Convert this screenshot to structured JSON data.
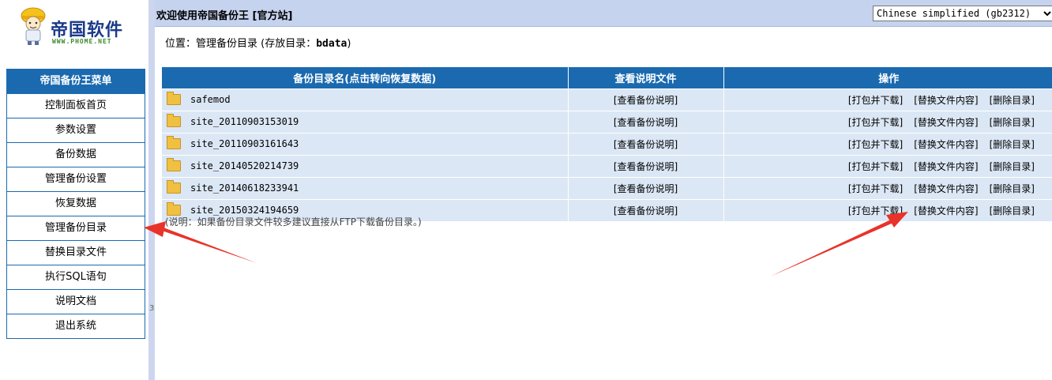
{
  "logo": {
    "brand": "帝国软件",
    "url": "WWW.PHOME.NET"
  },
  "menu": {
    "title": "帝国备份王菜单",
    "items": [
      {
        "label": "控制面板首页"
      },
      {
        "label": "参数设置"
      },
      {
        "label": "备份数据"
      },
      {
        "label": "管理备份设置"
      },
      {
        "label": "恢复数据"
      },
      {
        "label": "管理备份目录"
      },
      {
        "label": "替换目录文件"
      },
      {
        "label": "执行SQL语句"
      },
      {
        "label": "说明文档"
      },
      {
        "label": "退出系统"
      }
    ]
  },
  "splitter_mark": "3",
  "header": {
    "title": "欢迎使用帝国备份王 [官方站]",
    "language_select": "Chinese simplified (gb2312)"
  },
  "location": {
    "prefix": "位置：管理备份目录 (存放目录：",
    "dir": "bdata",
    "suffix": ")"
  },
  "table": {
    "headers": [
      "备份目录名(点击转向恢复数据)",
      "查看说明文件",
      "操作"
    ],
    "view_label": "[查看备份说明]",
    "actions": [
      "[打包并下载]",
      "[替换文件内容]",
      "[删除目录]"
    ],
    "rows": [
      {
        "name": "safemod"
      },
      {
        "name": "site_20110903153019"
      },
      {
        "name": "site_20110903161643"
      },
      {
        "name": "site_20140520214739"
      },
      {
        "name": "site_20140618233941"
      },
      {
        "name": "site_20150324194659"
      }
    ]
  },
  "note": "(说明：如果备份目录文件较多建议直接从FTP下载备份目录。)",
  "colors": {
    "accent": "#1b6ab0",
    "row_bg": "#dbe7f5",
    "header_bar": "#c6d3ef",
    "arrow": "#e8332a"
  }
}
